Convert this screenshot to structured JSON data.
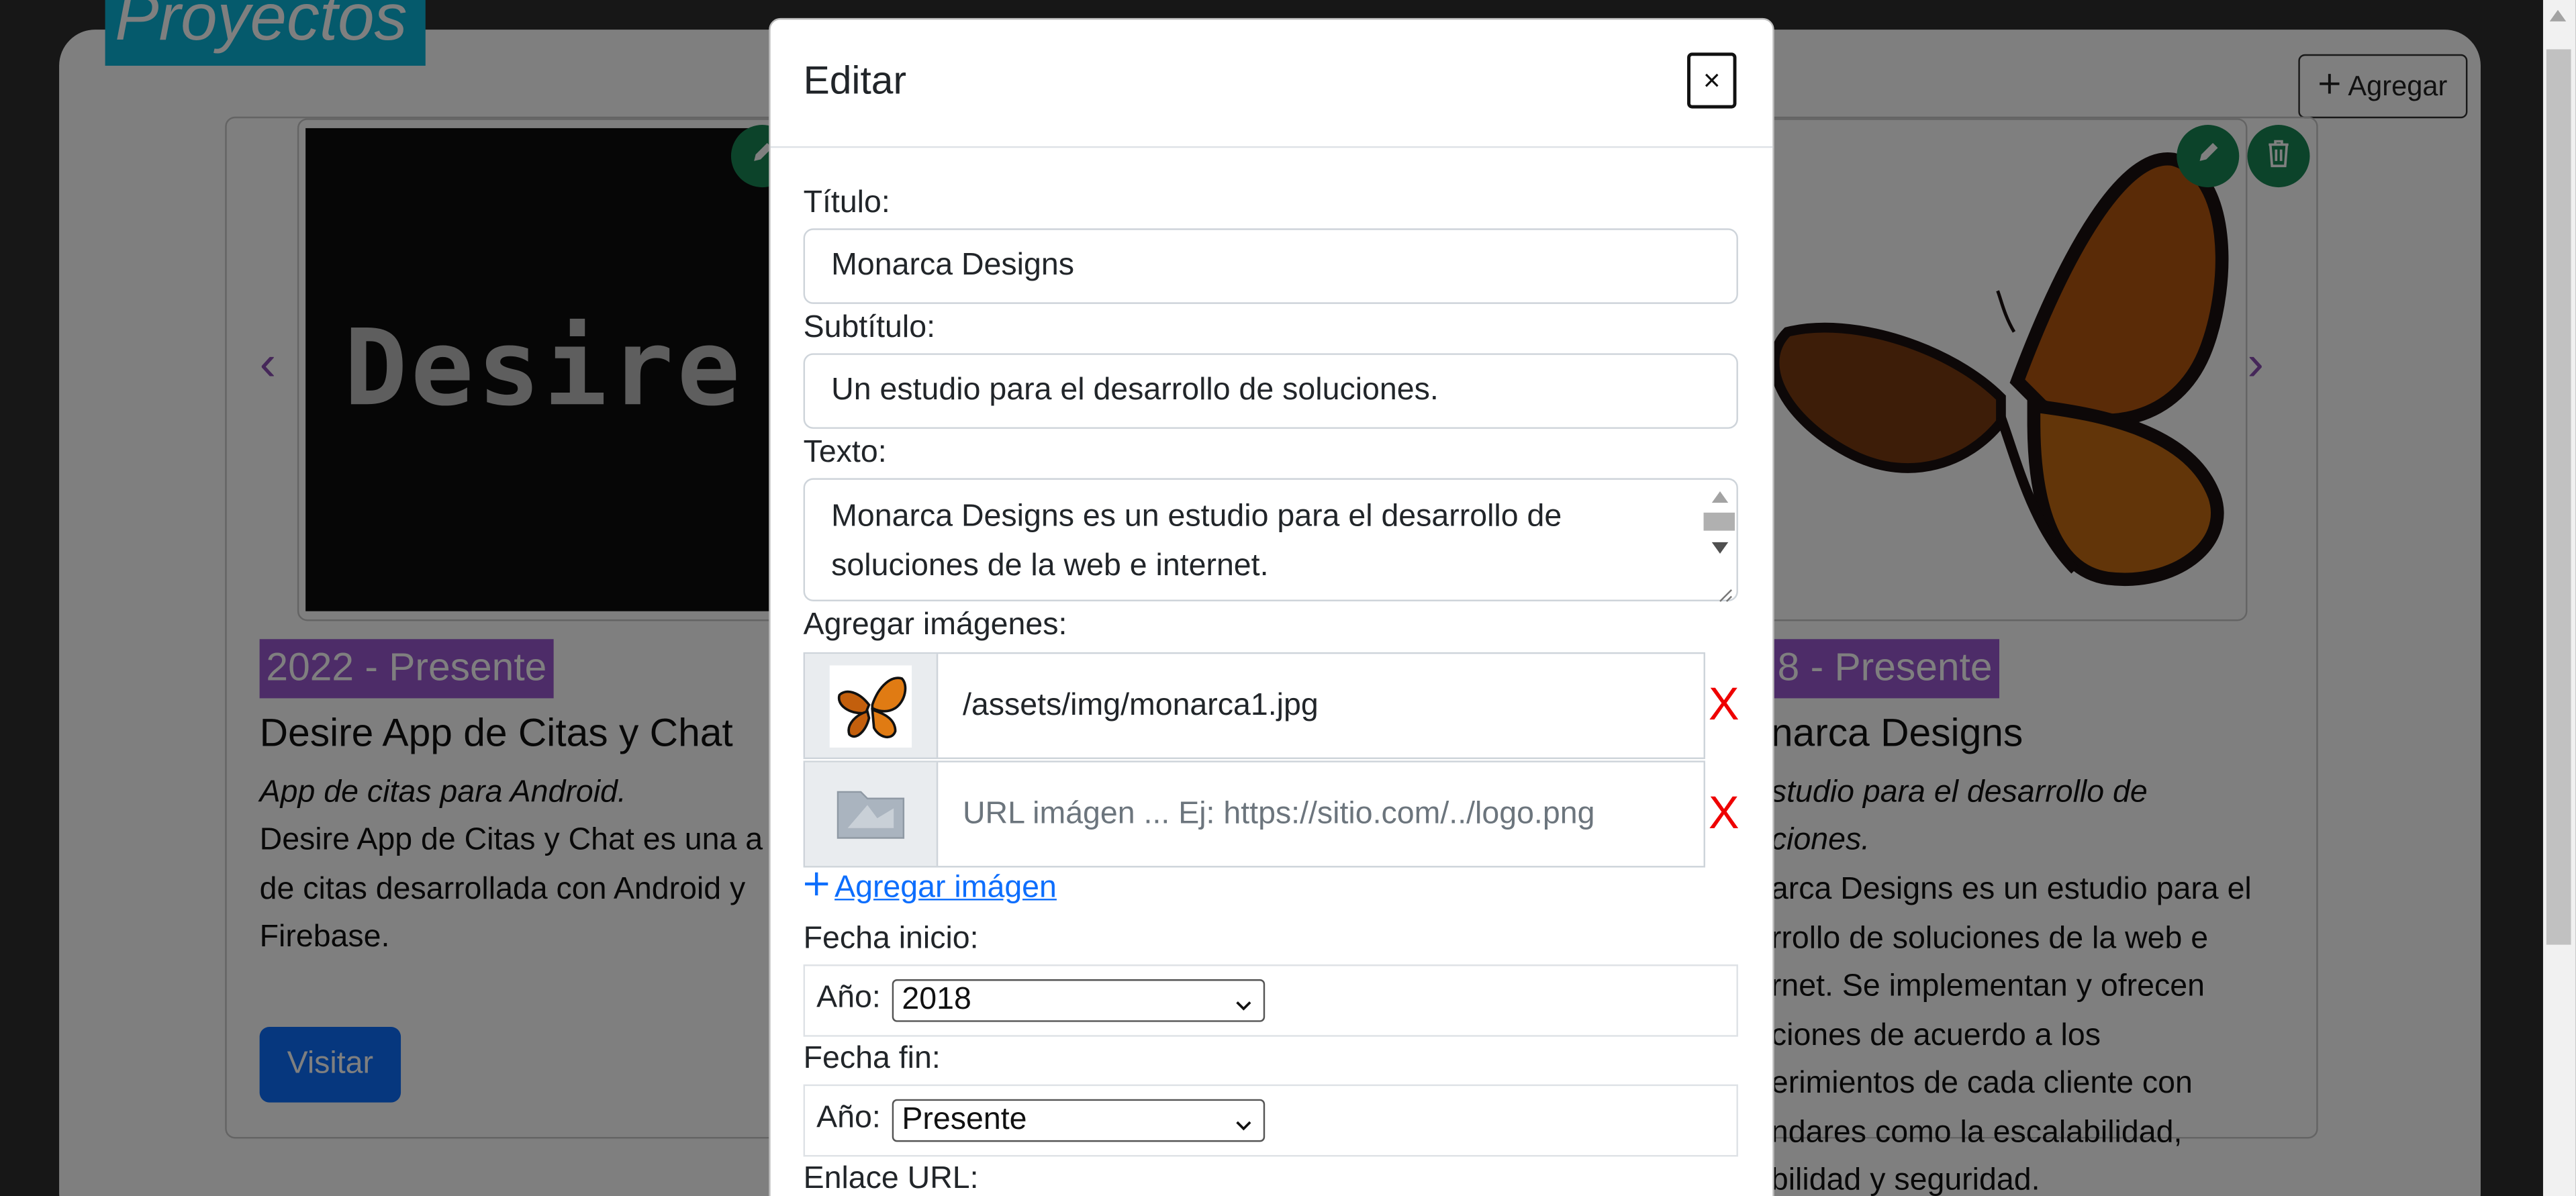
{
  "page": {
    "section_title": "Proyectos",
    "add_button": "Agregar",
    "projects": [
      {
        "image_text": "Desire",
        "date": "2022 - Presente",
        "title": "Desire App de Citas y Chat",
        "subtitle": "App de citas para Android.",
        "text_lines": [
          "Desire App de Citas y Chat es una a",
          "de citas desarrollada con Android y",
          "Firebase."
        ],
        "visit_label": "Visitar"
      },
      {
        "date": "8 - Presente",
        "title": "narca Designs",
        "subtitle_lines": [
          "studio para el desarrollo de",
          "ciones."
        ],
        "text_lines": [
          "arca Designs es un estudio para el",
          "rrollo de soluciones de la web e",
          "rnet. Se implementan y ofrecen",
          "ciones de acuerdo a los",
          "erimientos de cada cliente con",
          "ndares como la escalabilidad,",
          "bilidad y seguridad."
        ]
      }
    ]
  },
  "modal": {
    "title": "Editar",
    "close_label": "×",
    "titulo_label": "Título:",
    "titulo_value": "Monarca Designs",
    "subtitulo_label": "Subtítulo:",
    "subtitulo_value": "Un estudio para el desarrollo de soluciones.",
    "texto_label": "Texto:",
    "texto_value": "Monarca Designs es un estudio para el desarrollo de soluciones de la web e internet.",
    "imagenes_label": "Agregar imágenes:",
    "images": [
      {
        "value": "/assets/img/monarca1.jpg",
        "placeholder": ""
      },
      {
        "value": "",
        "placeholder": "URL imágen ... Ej: https://sitio.com/../logo.png"
      }
    ],
    "remove_label": "X",
    "add_image_link": "Agregar imágen",
    "fecha_inicio_label": "Fecha inicio:",
    "anio_label": "Año:",
    "fecha_inicio_value": "2018",
    "fecha_fin_label": "Fecha fin:",
    "fecha_fin_value": "Presente",
    "enlace_label": "Enlace URL:"
  },
  "colors": {
    "accent_cyan": "#0ab5d8",
    "badge_purple": "#9b59d0",
    "primary_blue": "#0d6efd",
    "success_green": "#198754",
    "danger_red": "#e00000"
  }
}
